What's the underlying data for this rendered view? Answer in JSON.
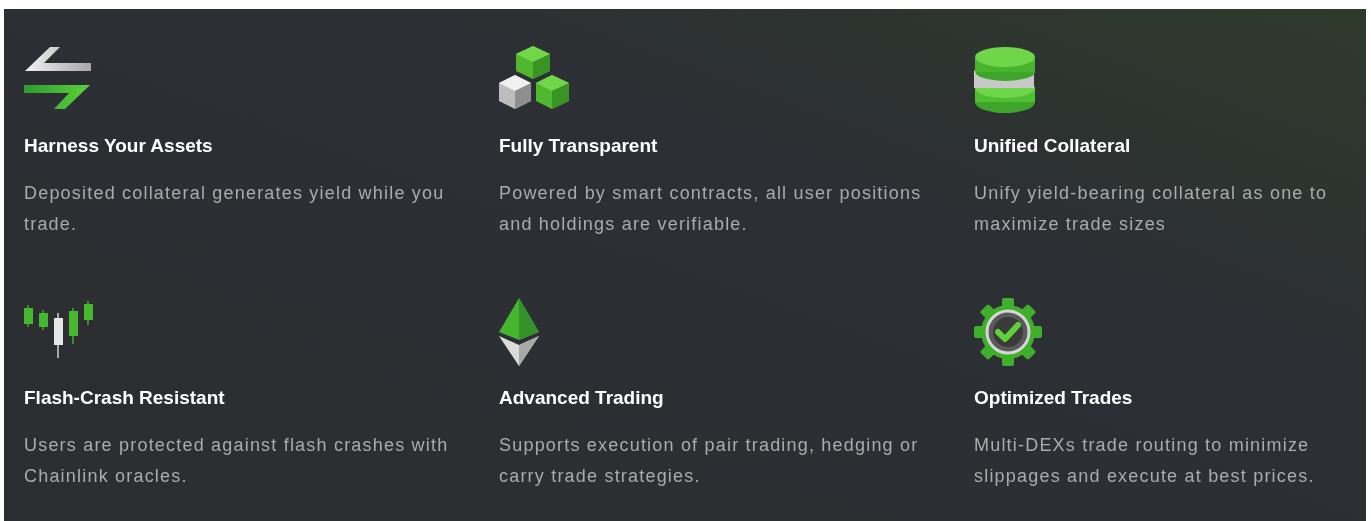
{
  "features": [
    {
      "kind": "swap",
      "title": "Harness Your Assets",
      "description": "Deposited collateral generates yield while you trade."
    },
    {
      "kind": "cubes",
      "title": "Fully Transparent",
      "description": "Powered by smart contracts, all user positions and holdings are verifiable."
    },
    {
      "kind": "stack",
      "title": "Unified Collateral",
      "description": "Unify yield-bearing collateral as one to maximize trade sizes"
    },
    {
      "kind": "candles",
      "title": "Flash-Crash Resistant",
      "description": "Users are protected against flash crashes with Chainlink oracles."
    },
    {
      "kind": "diamond",
      "title": "Advanced Trading",
      "description": "Supports execution of pair trading, hedging or carry trade strategies."
    },
    {
      "kind": "gear",
      "title": "Optimized Trades",
      "description": "Multi-DEXs trade routing to minimize slippages and execute at best prices."
    }
  ]
}
